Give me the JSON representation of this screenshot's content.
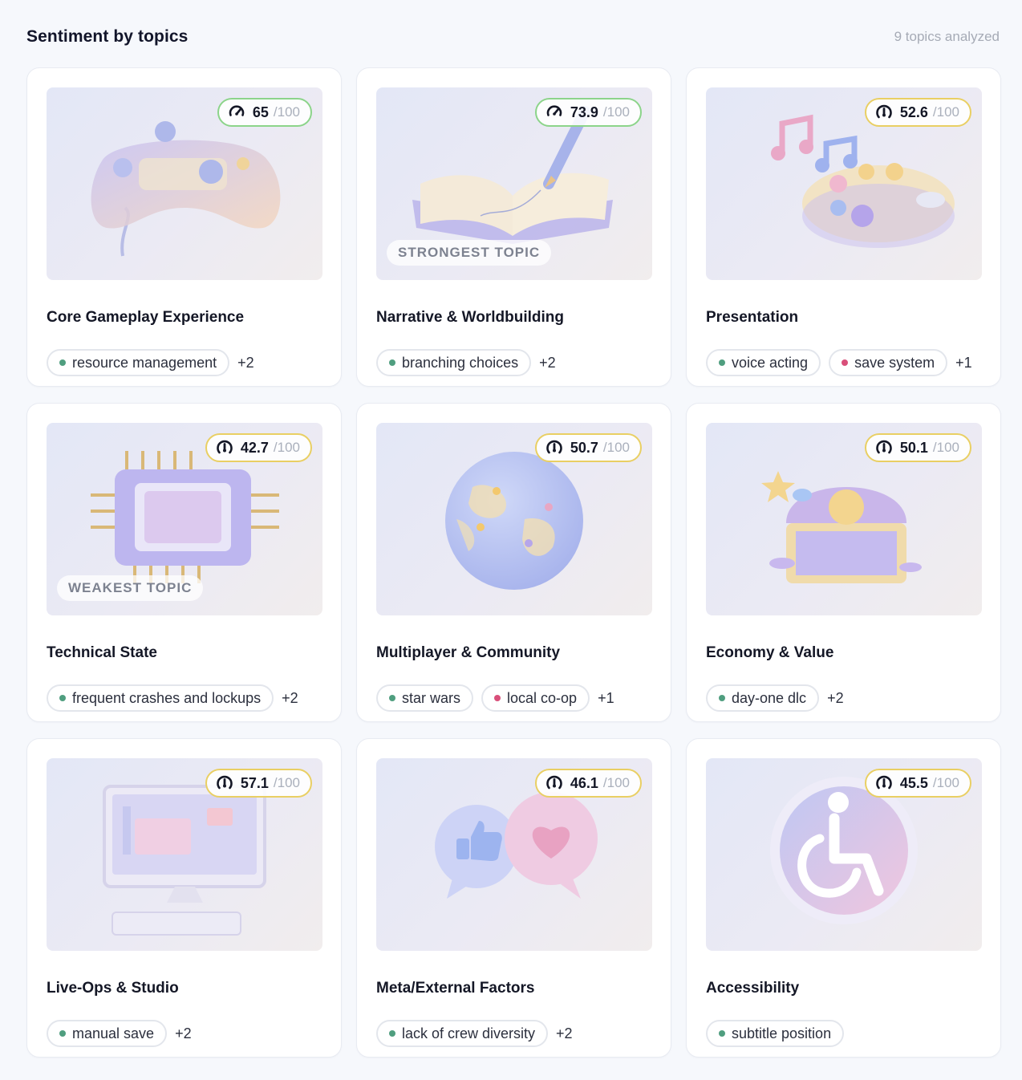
{
  "header": {
    "title": "Sentiment by topics",
    "meta": "9 topics analyzed"
  },
  "score_max": "/100",
  "colors": {
    "good_border": "#8cd48a",
    "mid_border": "#e9cf63",
    "positive_dot": "#4f9e7f",
    "negative_dot": "#d94f7a"
  },
  "topics": [
    {
      "title": "Core Gameplay Experience",
      "score": "65",
      "level": "good",
      "illustration": "game-controller",
      "tags": [
        {
          "label": "resource management",
          "sentiment": "positive"
        }
      ],
      "more": "+2"
    },
    {
      "title": "Narrative & Worldbuilding",
      "score": "73.9",
      "level": "good",
      "illustration": "open-book-with-pen",
      "badge": "STRONGEST TOPIC",
      "tags": [
        {
          "label": "branching choices",
          "sentiment": "positive"
        }
      ],
      "more": "+2"
    },
    {
      "title": "Presentation",
      "score": "52.6",
      "level": "mid",
      "illustration": "music-notes-and-palette",
      "tags": [
        {
          "label": "voice acting",
          "sentiment": "positive"
        },
        {
          "label": "save system",
          "sentiment": "negative"
        }
      ],
      "more": "+1"
    },
    {
      "title": "Technical State",
      "score": "42.7",
      "level": "mid",
      "illustration": "cpu-chip",
      "badge": "WEAKEST TOPIC",
      "tags": [
        {
          "label": "frequent crashes and lockups",
          "sentiment": "positive"
        }
      ],
      "more": "+2"
    },
    {
      "title": "Multiplayer & Community",
      "score": "50.7",
      "level": "mid",
      "illustration": "globe-with-players",
      "tags": [
        {
          "label": "star wars",
          "sentiment": "positive"
        },
        {
          "label": "local co-op",
          "sentiment": "negative"
        }
      ],
      "more": "+1"
    },
    {
      "title": "Economy & Value",
      "score": "50.1",
      "level": "mid",
      "illustration": "treasure-chest",
      "tags": [
        {
          "label": "day-one dlc",
          "sentiment": "positive"
        }
      ],
      "more": "+2"
    },
    {
      "title": "Live-Ops & Studio",
      "score": "57.1",
      "level": "mid",
      "illustration": "desktop-computer",
      "tags": [
        {
          "label": "manual save",
          "sentiment": "positive"
        }
      ],
      "more": "+2"
    },
    {
      "title": "Meta/External Factors",
      "score": "46.1",
      "level": "mid",
      "illustration": "chat-bubbles-like-heart",
      "tags": [
        {
          "label": "lack of crew diversity",
          "sentiment": "positive"
        }
      ],
      "more": "+2"
    },
    {
      "title": "Accessibility",
      "score": "45.5",
      "level": "mid",
      "illustration": "wheelchair-symbol",
      "tags": [
        {
          "label": "subtitle position",
          "sentiment": "positive"
        }
      ],
      "more": ""
    }
  ]
}
